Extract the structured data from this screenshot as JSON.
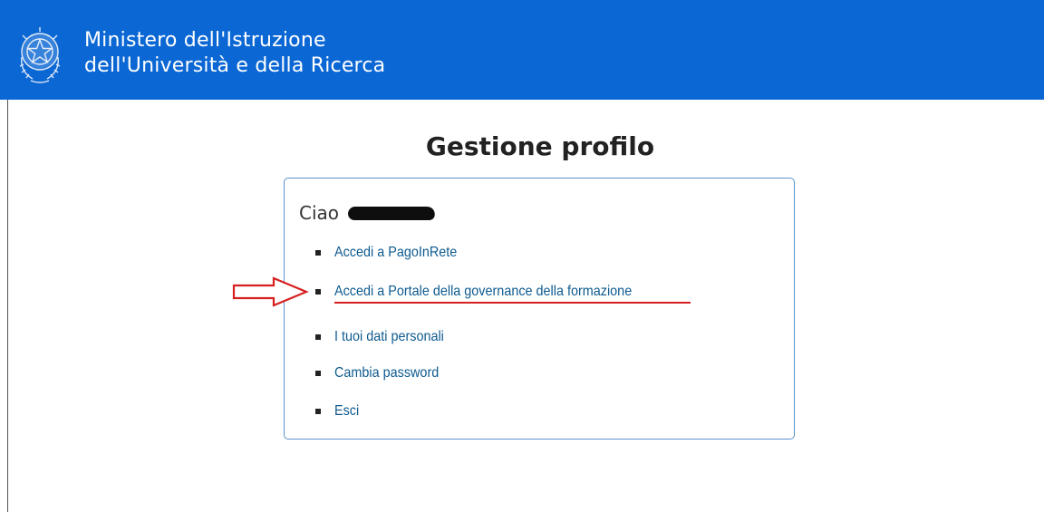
{
  "header": {
    "title_line1": "Ministero dell'Istruzione",
    "title_line2": "dell'Università e della Ricerca",
    "emblem_icon": "italian-republic-emblem-icon",
    "background_color": "#0b67d4"
  },
  "page": {
    "title": "Gestione profilo"
  },
  "panel": {
    "greeting": "Ciao",
    "border_color": "#5a93c9",
    "menu_items": [
      {
        "label": "Accedi a PagoInRete"
      },
      {
        "label": "Accedi a Portale della governance della formazione"
      },
      {
        "label": "I tuoi dati personali"
      },
      {
        "label": "Cambia password"
      },
      {
        "label": "Esci"
      }
    ],
    "link_color": "#0d5a8f"
  },
  "annotation": {
    "arrow_icon": "red-outline-right-arrow-icon",
    "underline_color": "#d62020"
  }
}
